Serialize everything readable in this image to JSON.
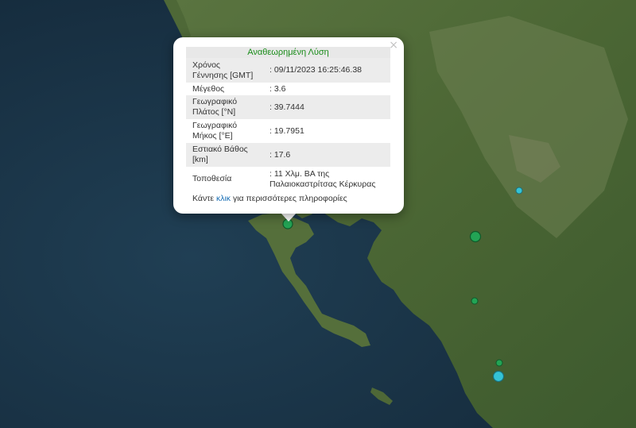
{
  "popup": {
    "title": "Αναθεωρημένη Λύση",
    "close": "×",
    "rows": [
      {
        "key": "Χρόνος Γέννησης [GMT]",
        "value": ": 09/11/2023 16:25:46.38"
      },
      {
        "key": "Μέγεθος",
        "value": ": 3.6"
      },
      {
        "key": "Γεωγραφικό Πλάτος [°N]",
        "value": ": 39.7444"
      },
      {
        "key": "Γεωγραφικό Μήκος [°E]",
        "value": ": 19.7951"
      },
      {
        "key": "Εστιακό Βάθος [km]",
        "value": ": 17.6"
      },
      {
        "key": "Τοποθεσία",
        "value": ": 11 Χλμ. ΒΑ της Παλαιοκαστρίτσας Κέρκυρας"
      }
    ],
    "more_prefix": "Κάντε ",
    "more_link": "κλικ",
    "more_suffix": " για περισσότερες πληροφορίες"
  },
  "colors": {
    "sea": "#1c3a4f",
    "land": "#4f6a39",
    "marker_green": "#23a455",
    "marker_cyan": "#34c3d6",
    "title_text": "#1a8c1a",
    "link": "#1a6fb5"
  }
}
